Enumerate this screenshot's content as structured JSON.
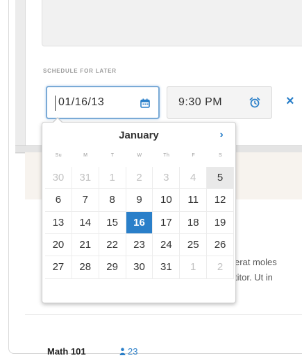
{
  "schedule": {
    "label": "SCHEDULE FOR LATER",
    "date_value": "01/16/13",
    "time_value": "9:30 PM"
  },
  "datepicker": {
    "month": "January",
    "next_label": "›",
    "weekdays": [
      "Su",
      "M",
      "T",
      "W",
      "Th",
      "F",
      "S"
    ],
    "days": [
      {
        "label": "30",
        "muted": true
      },
      {
        "label": "31",
        "muted": true
      },
      {
        "label": "1",
        "muted": true
      },
      {
        "label": "2",
        "muted": true
      },
      {
        "label": "3",
        "muted": true
      },
      {
        "label": "4",
        "muted": true
      },
      {
        "label": "5",
        "today": true
      },
      {
        "label": "6"
      },
      {
        "label": "7"
      },
      {
        "label": "8"
      },
      {
        "label": "9"
      },
      {
        "label": "10"
      },
      {
        "label": "11"
      },
      {
        "label": "12"
      },
      {
        "label": "13"
      },
      {
        "label": "14"
      },
      {
        "label": "15"
      },
      {
        "label": "16",
        "selected": true
      },
      {
        "label": "17"
      },
      {
        "label": "18"
      },
      {
        "label": "19"
      },
      {
        "label": "20"
      },
      {
        "label": "21"
      },
      {
        "label": "22"
      },
      {
        "label": "23"
      },
      {
        "label": "24"
      },
      {
        "label": "25"
      },
      {
        "label": "26"
      },
      {
        "label": "27"
      },
      {
        "label": "28"
      },
      {
        "label": "29"
      },
      {
        "label": "30"
      },
      {
        "label": "31"
      },
      {
        "label": "1",
        "muted": true
      },
      {
        "label": "2",
        "muted": true
      }
    ]
  },
  "clear_label": "×",
  "body_text": {
    "line1": "erat moles",
    "line2": "titor. Ut in"
  },
  "course": {
    "title": "Math 101",
    "member_count": "23"
  },
  "colors": {
    "accent": "#2a7fc9",
    "focus_border": "#7aaad6"
  },
  "icons": {
    "date_field": "calendar-icon",
    "time_field": "alarm-clock-icon",
    "clear": "close-icon",
    "next_month": "chevron-right-icon",
    "members": "person-icon"
  }
}
